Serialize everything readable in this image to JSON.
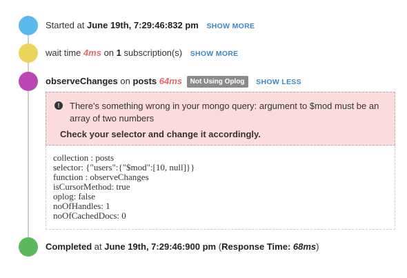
{
  "colors": {
    "dot_started": "#5bb8ec",
    "dot_wait": "#ead45c",
    "dot_observe": "#bb47b5",
    "dot_completed": "#5cb85c"
  },
  "started": {
    "prefix": "Started at",
    "time": "June 19th, 7:29:46:832 pm",
    "link": "SHOW MORE"
  },
  "wait": {
    "prefix": "wait time",
    "duration": "4ms",
    "mid": "on",
    "count": "1",
    "suffix": "subscription(s)",
    "link": "SHOW MORE"
  },
  "observe": {
    "method": "observeChanges",
    "mid": "on",
    "collection": "posts",
    "duration": "64ms",
    "badge": "Not Using Oplog",
    "link": "SHOW LESS"
  },
  "error": {
    "icon": "exclamation-circle-icon",
    "message": "There's something wrong in your mongo query: argument to $mod must be an array of two numbers",
    "hint": "Check your selector and change it accordingly."
  },
  "details": [
    "collection : posts",
    "selector: {\"users\":{\"$mod\":[10, null]}}",
    "function : observeChanges",
    "isCursorMethod: true",
    "oplog: false",
    "noOfHandles: 1",
    "noOfCachedDocs: 0"
  ],
  "completed": {
    "label": "Completed",
    "prefix": "at",
    "time": "June 19th, 7:29:46:900 pm",
    "open_paren": "(",
    "response_label": "Response Time:",
    "response_value": "68ms",
    "close_paren": ")"
  }
}
